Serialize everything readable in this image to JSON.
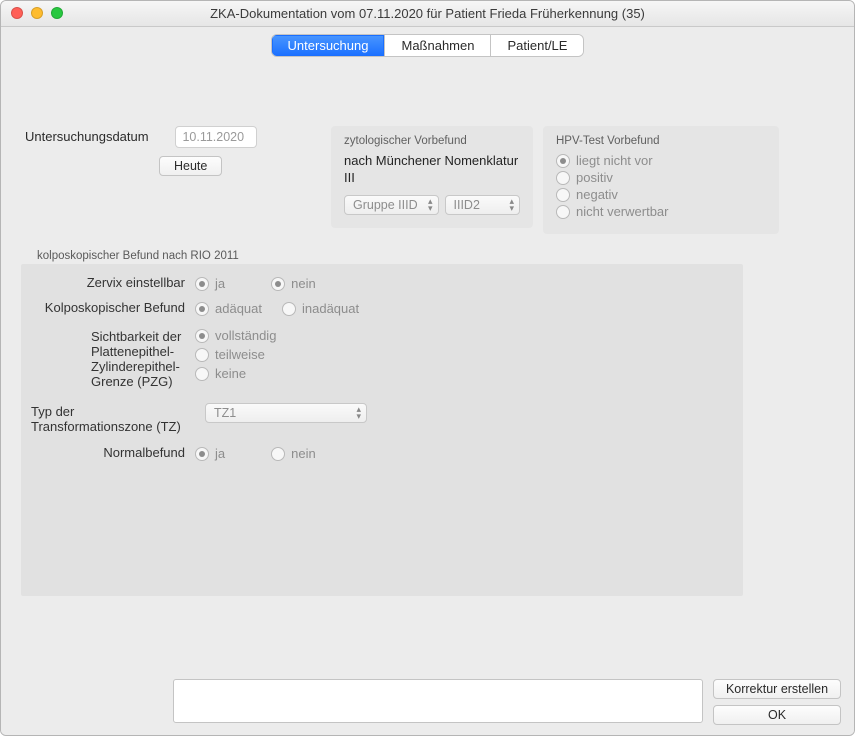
{
  "window": {
    "title": "ZKA-Dokumentation vom 07.11.2020 für Patient Frieda Früherkennung (35)"
  },
  "tabs": {
    "t1": "Untersuchung",
    "t2": "Maßnahmen",
    "t3": "Patient/LE"
  },
  "date": {
    "label": "Untersuchungsdatum",
    "value": "10.11.2020",
    "today_btn": "Heute"
  },
  "zyto": {
    "title": "zytologischer Vorbefund",
    "text": "nach Münchener Nomenklatur III",
    "sel1": "Gruppe IIID",
    "sel2": "IIID2"
  },
  "hpv": {
    "title": "HPV-Test Vorbefund",
    "o1": "liegt nicht vor",
    "o2": "positiv",
    "o3": "negativ",
    "o4": "nicht verwertbar"
  },
  "rio": {
    "title": "kolposkopischer Befund nach RIO 2011",
    "zervix": {
      "label": "Zervix einstellbar",
      "ja": "ja",
      "nein": "nein"
    },
    "kolpo": {
      "label": "Kolposkopischer Befund",
      "a": "adäquat",
      "b": "inadäquat"
    },
    "pzg": {
      "label": "Sichtbarkeit der Plattenepithel-Zylinderepithel-Grenze (PZG)",
      "o1": "vollständig",
      "o2": "teilweise",
      "o3": "keine"
    },
    "tz": {
      "label": "Typ der Transformationszone (TZ)",
      "sel": "TZ1"
    },
    "normal": {
      "label": "Normalbefund",
      "ja": "ja",
      "nein": "nein"
    }
  },
  "footer": {
    "korrektur": "Korrektur erstellen",
    "ok": "OK"
  }
}
